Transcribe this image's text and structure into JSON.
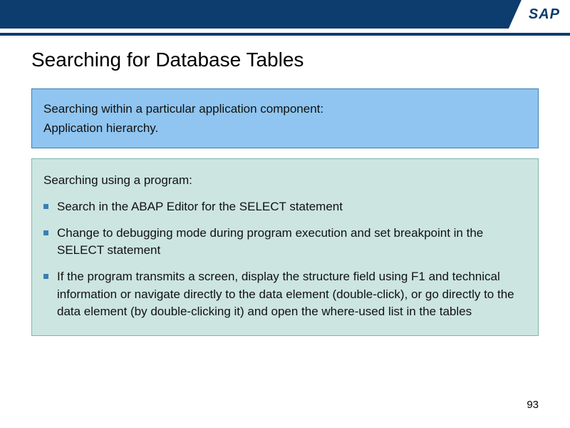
{
  "logo": "SAP",
  "title": "Searching for Database Tables",
  "box1": {
    "line1": "Searching within a particular application component:",
    "line2": "Application hierarchy."
  },
  "box2": {
    "heading": "Searching using a program:",
    "bullets": [
      "Search in the ABAP Editor for the SELECT statement",
      "Change to debugging mode during program execution and set breakpoint in the SELECT statement",
      "If the program transmits a screen, display the structure field using F1 and technical information or navigate directly to the data element (double-click), or go directly to the data element (by double-clicking it) and open the where-used list in the tables"
    ]
  },
  "page_number": "93"
}
